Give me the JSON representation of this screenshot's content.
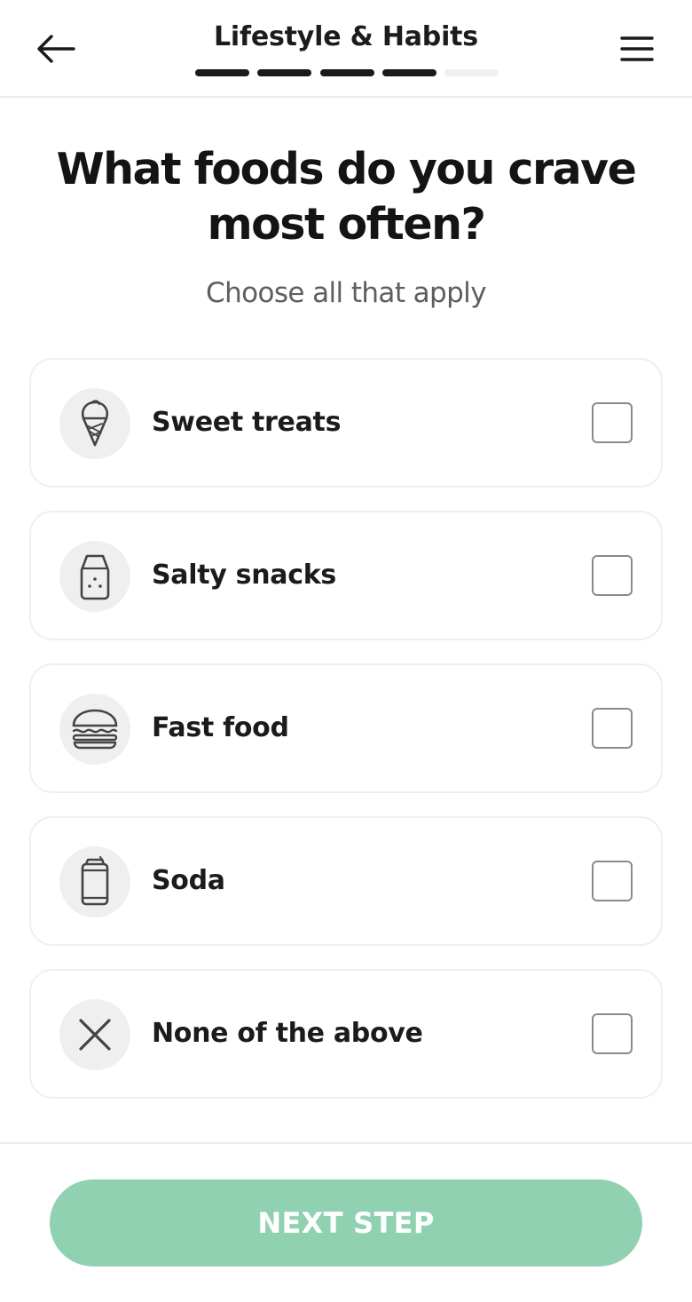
{
  "header": {
    "title": "Lifestyle & Habits",
    "back_icon": "arrow-left-icon",
    "menu_icon": "hamburger-menu-icon",
    "progress": {
      "completed_steps": 4,
      "total_steps": 5
    }
  },
  "question": {
    "title": "What foods do you crave most often?",
    "subtitle": "Choose all that apply"
  },
  "options": [
    {
      "label": "Sweet treats",
      "icon": "ice-cream-icon",
      "checked": false
    },
    {
      "label": "Salty snacks",
      "icon": "salt-shaker-icon",
      "checked": false
    },
    {
      "label": "Fast food",
      "icon": "burger-icon",
      "checked": false
    },
    {
      "label": "Soda",
      "icon": "soda-can-icon",
      "checked": false
    },
    {
      "label": "None of the above",
      "icon": "close-x-icon",
      "checked": false
    }
  ],
  "footer": {
    "next_label": "NEXT STEP"
  },
  "colors": {
    "accent": "#8fd1b1",
    "progress_done": "#1a1a1a",
    "progress_todo": "#f0f0f0",
    "text_primary": "#1a1a1a",
    "text_secondary": "#5e5e5e"
  }
}
